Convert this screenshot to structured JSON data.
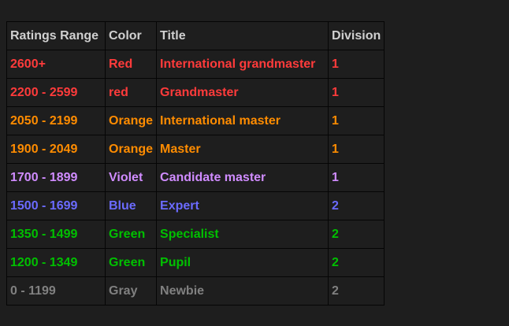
{
  "table": {
    "headers": [
      "Ratings Range",
      "Color",
      "Title",
      "Division"
    ],
    "rows": [
      {
        "range": "2600+",
        "color": "Red",
        "title": "International grandmaster",
        "division": "1",
        "hex": "#ff3b3b"
      },
      {
        "range": "2200 - 2599",
        "color": "red",
        "title": "Grandmaster",
        "division": "1",
        "hex": "#ff3b3b"
      },
      {
        "range": "2050 - 2199",
        "color": "Orange",
        "title": "International master",
        "division": "1",
        "hex": "#ff8c00"
      },
      {
        "range": "1900 - 2049",
        "color": "Orange",
        "title": "Master",
        "division": "1",
        "hex": "#ff8c00"
      },
      {
        "range": "1700 - 1899",
        "color": "Violet",
        "title": "Candidate master",
        "division": "1",
        "hex": "#d08cff"
      },
      {
        "range": "1500 - 1699",
        "color": "Blue",
        "title": "Expert",
        "division": "2",
        "hex": "#6b6bff"
      },
      {
        "range": "1350 - 1499",
        "color": "Green",
        "title": "Specialist",
        "division": "2",
        "hex": "#00c000"
      },
      {
        "range": "1200 - 1349",
        "color": "Green",
        "title": "Pupil",
        "division": "2",
        "hex": "#00c000"
      },
      {
        "range": "0 - 1199",
        "color": "Gray",
        "title": "Newbie",
        "division": "2",
        "hex": "#808080"
      }
    ]
  }
}
